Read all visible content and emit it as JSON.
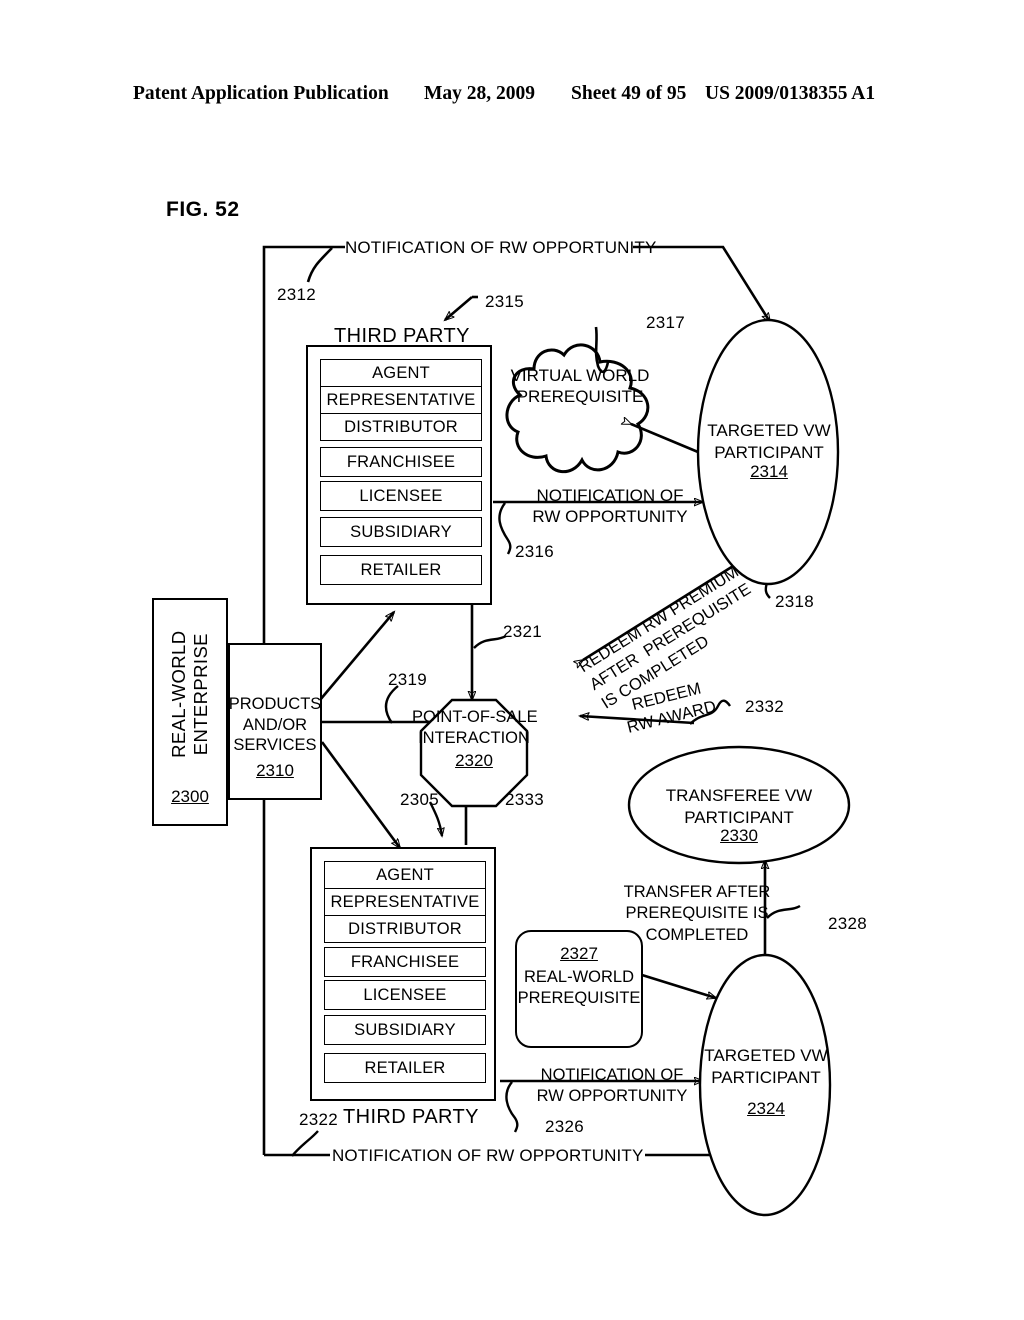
{
  "header": {
    "publication": "Patent Application Publication",
    "date": "May 28, 2009",
    "sheet": "Sheet 49 of 95",
    "patent_number": "US 2009/0138355 A1"
  },
  "figure": {
    "label": "FIG. 52"
  },
  "nodes": {
    "enterprise": {
      "title": "REAL-WORLD\nENTERPRISE",
      "ref": "2300"
    },
    "products": {
      "title": "PRODUCTS\nAND/OR\nSERVICES",
      "ref": "2310"
    },
    "third_party_top": {
      "title": "THIRD PARTY",
      "ref": "2315",
      "items": [
        "AGENT",
        "REPRESENTATIVE",
        "DISTRIBUTOR",
        "FRANCHISEE",
        "LICENSEE",
        "SUBSIDIARY",
        "RETAILER"
      ]
    },
    "third_party_bottom": {
      "title": "THIRD PARTY",
      "ref": "2322",
      "items": [
        "AGENT",
        "REPRESENTATIVE",
        "DISTRIBUTOR",
        "FRANCHISEE",
        "LICENSEE",
        "SUBSIDIARY",
        "RETAILER"
      ]
    },
    "virtual_world_prerequisite": {
      "title": "VIRTUAL WORLD\nPREREQUISITE",
      "ref": "2317"
    },
    "targeted_vw_participant_top": {
      "title": "TARGETED VW\nPARTICIPANT",
      "ref": "2314"
    },
    "point_of_sale": {
      "title": "POINT-OF-SALE\nINTERACTION",
      "ref": "2320"
    },
    "transferee_vw_participant": {
      "title": "TRANSFEREE VW\nPARTICIPANT",
      "ref": "2330"
    },
    "real_world_prerequisite": {
      "title": "REAL-WORLD\nPREREQUISITE",
      "ref": "2327"
    },
    "targeted_vw_participant_bottom": {
      "title": "TARGETED VW\nPARTICIPANT",
      "ref": "2324"
    }
  },
  "edges": {
    "notification_top": {
      "label": "NOTIFICATION OF RW OPPORTUNITY",
      "ref": "2312"
    },
    "notification_mid": {
      "label": "NOTIFICATION OF\nRW OPPORTUNITY",
      "ref": "2316"
    },
    "redeem_premium": {
      "label": "REDEEM RW PREMIUM\nAFTER  PREREQUISITE\nIS COMPLETED",
      "ref": "2318"
    },
    "pos_from_third_party_top": {
      "ref": "2321"
    },
    "pos_from_products": {
      "ref": "2319"
    },
    "products_to_third_party_bottom": {
      "ref": "2305"
    },
    "pos_from_third_party_bottom": {
      "ref": "2333"
    },
    "redeem_award": {
      "label": "REDEEM\nRW AWARD",
      "ref": "2332"
    },
    "transfer_after": {
      "label": "TRANSFER AFTER\nPREREQUISITE IS\nCOMPLETED",
      "ref": "2328"
    },
    "notification_lower": {
      "label": "NOTIFICATION OF\nRW OPPORTUNITY",
      "ref": "2326"
    },
    "notification_bottom": {
      "label": "NOTIFICATION OF RW OPPORTUNITY"
    }
  },
  "colors": {
    "ink": "#000000",
    "paper": "#ffffff"
  }
}
